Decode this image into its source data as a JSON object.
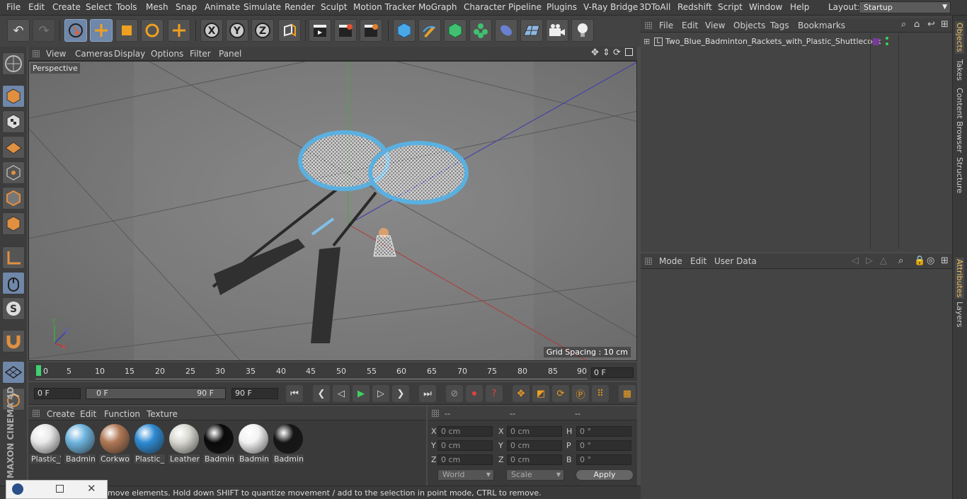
{
  "menu": [
    "File",
    "Edit",
    "Create",
    "Select",
    "Tools",
    "Mesh",
    "Snap",
    "Animate",
    "Simulate",
    "Render",
    "Sculpt",
    "Motion Tracker",
    "MoGraph",
    "Character",
    "Pipeline",
    "Plugins",
    "V-Ray Bridge",
    "3DToAll",
    "Redshift",
    "Script",
    "Window",
    "Help"
  ],
  "layout": {
    "label": "Layout:",
    "value": "Startup"
  },
  "viewport": {
    "menu": [
      "View",
      "Cameras",
      "Display",
      "Options",
      "Filter",
      "Panel"
    ],
    "label": "Perspective",
    "grid_spacing": "Grid Spacing : 10 cm"
  },
  "timeline": {
    "ticks": [
      "0",
      "5",
      "10",
      "15",
      "20",
      "25",
      "30",
      "35",
      "40",
      "45",
      "50",
      "55",
      "60",
      "65",
      "70",
      "75",
      "80",
      "85",
      "90"
    ],
    "current_frame": "0 F"
  },
  "transport": {
    "start": "0 F",
    "range_start": "0 F",
    "range_end": "90 F",
    "end": "90 F"
  },
  "materials": {
    "menu": [
      "Create",
      "Edit",
      "Function",
      "Texture"
    ],
    "items": [
      {
        "label": "Plastic_\\",
        "color": "#e8e8e8"
      },
      {
        "label": "Badmint",
        "color": "#6fb4de"
      },
      {
        "label": "Corkwo",
        "color": "#b07855"
      },
      {
        "label": "Plastic_(",
        "color": "#2e8bd2"
      },
      {
        "label": "Leather",
        "color": "#d8d8d0"
      },
      {
        "label": "Badmint",
        "color": "#0a0a0a"
      },
      {
        "label": "Badmint",
        "color": "#f2f2f2"
      },
      {
        "label": "Badmint",
        "color": "#151515"
      }
    ]
  },
  "coords": {
    "headers": [
      "--",
      "--",
      "--"
    ],
    "rows": [
      {
        "a": "X",
        "av": "0 cm",
        "b": "X",
        "bv": "0 cm",
        "c": "H",
        "cv": "0 °"
      },
      {
        "a": "Y",
        "av": "0 cm",
        "b": "Y",
        "bv": "0 cm",
        "c": "P",
        "cv": "0 °"
      },
      {
        "a": "Z",
        "av": "0 cm",
        "b": "Z",
        "bv": "0 cm",
        "c": "B",
        "cv": "0 °"
      }
    ],
    "world": "World",
    "scale": "Scale",
    "apply": "Apply"
  },
  "status": "move elements. Hold down SHIFT to quantize movement / add to the selection in point mode, CTRL to remove.",
  "objects": {
    "menu": [
      "File",
      "Edit",
      "View",
      "Objects",
      "Tags",
      "Bookmarks"
    ],
    "item": "Two_Blue_Badminton_Rackets_with_Plastic_Shuttlecock"
  },
  "attributes": {
    "menu": [
      "Mode",
      "Edit",
      "User Data"
    ]
  },
  "side_tabs": [
    "Objects",
    "Takes",
    "Content Browser",
    "Structure",
    "Attributes",
    "Layers"
  ],
  "brand": "MAXON CINEMA 4D"
}
